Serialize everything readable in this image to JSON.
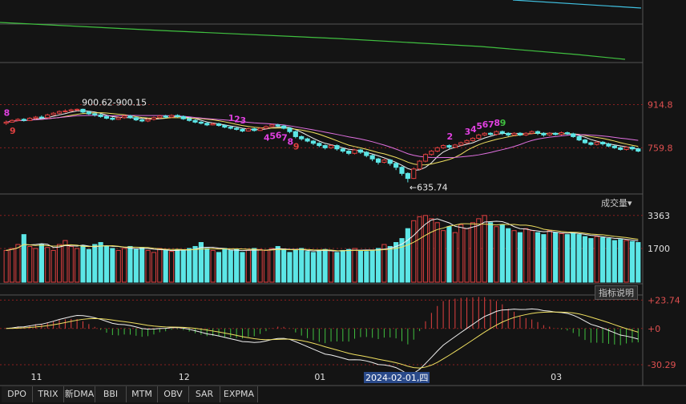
{
  "chart_data": {
    "type": "candlestick",
    "colors": {
      "up": "#e04040",
      "down": "#5ce6e6",
      "ma5": "#f0f0f0",
      "ma10": "#f0e060",
      "ma20": "#e070e0",
      "ma60": "#40c040",
      "ma120": "#40c0e0",
      "grid": "#8a1f1f",
      "axis_text": "#e05050",
      "td_up": "#e040e0",
      "td_down": "#e04040"
    },
    "price_panel": {
      "ylim": [
        600,
        1060
      ],
      "ticks": [
        {
          "value": 914.8,
          "label": "914.8"
        },
        {
          "value": 759.8,
          "label": "759.8"
        }
      ],
      "high_annotation": "900.62-900.15",
      "low_annotation": "←635.74",
      "candles": [
        [
          848,
          852,
          842,
          858
        ],
        [
          852,
          858,
          850,
          862
        ],
        [
          858,
          862,
          855,
          866
        ],
        [
          862,
          858,
          854,
          866
        ],
        [
          858,
          866,
          856,
          870
        ],
        [
          866,
          870,
          862,
          874
        ],
        [
          870,
          868,
          864,
          876
        ],
        [
          868,
          878,
          866,
          882
        ],
        [
          878,
          884,
          876,
          888
        ],
        [
          884,
          890,
          880,
          894
        ],
        [
          890,
          892,
          886,
          898
        ],
        [
          892,
          896,
          890,
          900
        ],
        [
          896,
          898,
          892,
          901
        ],
        [
          898,
          888,
          884,
          900
        ],
        [
          888,
          882,
          878,
          892
        ],
        [
          882,
          878,
          872,
          886
        ],
        [
          878,
          872,
          868,
          882
        ],
        [
          872,
          866,
          862,
          876
        ],
        [
          866,
          862,
          858,
          870
        ],
        [
          862,
          868,
          860,
          872
        ],
        [
          868,
          874,
          864,
          878
        ],
        [
          874,
          868,
          864,
          878
        ],
        [
          868,
          860,
          856,
          872
        ],
        [
          860,
          856,
          852,
          864
        ],
        [
          856,
          862,
          852,
          866
        ],
        [
          862,
          868,
          858,
          872
        ],
        [
          868,
          874,
          864,
          878
        ],
        [
          874,
          870,
          866,
          878
        ],
        [
          870,
          876,
          866,
          880
        ],
        [
          876,
          872,
          868,
          880
        ],
        [
          872,
          864,
          860,
          876
        ],
        [
          864,
          858,
          854,
          868
        ],
        [
          858,
          852,
          848,
          862
        ],
        [
          852,
          848,
          844,
          856
        ],
        [
          848,
          842,
          838,
          852
        ],
        [
          842,
          846,
          840,
          850
        ],
        [
          846,
          840,
          836,
          850
        ],
        [
          840,
          834,
          830,
          844
        ],
        [
          834,
          830,
          826,
          838
        ],
        [
          830,
          826,
          822,
          834
        ],
        [
          826,
          820,
          816,
          830
        ],
        [
          820,
          828,
          818,
          832
        ],
        [
          828,
          822,
          818,
          832
        ],
        [
          822,
          830,
          820,
          834
        ],
        [
          830,
          836,
          826,
          840
        ],
        [
          836,
          842,
          832,
          846
        ],
        [
          842,
          838,
          834,
          846
        ],
        [
          838,
          830,
          826,
          842
        ],
        [
          830,
          818,
          812,
          834
        ],
        [
          818,
          800,
          794,
          822
        ],
        [
          800,
          792,
          786,
          804
        ],
        [
          792,
          784,
          780,
          796
        ],
        [
          784,
          776,
          770,
          788
        ],
        [
          776,
          768,
          762,
          780
        ],
        [
          768,
          760,
          754,
          772
        ],
        [
          760,
          768,
          756,
          772
        ],
        [
          768,
          756,
          750,
          772
        ],
        [
          756,
          748,
          742,
          760
        ],
        [
          748,
          740,
          734,
          752
        ],
        [
          740,
          752,
          736,
          756
        ],
        [
          752,
          744,
          738,
          756
        ],
        [
          744,
          732,
          726,
          748
        ],
        [
          732,
          720,
          712,
          736
        ],
        [
          720,
          708,
          700,
          724
        ],
        [
          708,
          716,
          704,
          720
        ],
        [
          716,
          704,
          696,
          720
        ],
        [
          704,
          690,
          680,
          708
        ],
        [
          690,
          668,
          660,
          694
        ],
        [
          668,
          650,
          636,
          672
        ],
        [
          650,
          684,
          648,
          690
        ],
        [
          684,
          712,
          680,
          716
        ],
        [
          712,
          736,
          708,
          740
        ],
        [
          736,
          748,
          732,
          752
        ],
        [
          748,
          760,
          744,
          764
        ],
        [
          760,
          768,
          756,
          772
        ],
        [
          768,
          762,
          756,
          772
        ],
        [
          762,
          770,
          758,
          774
        ],
        [
          770,
          778,
          766,
          782
        ],
        [
          778,
          786,
          774,
          790
        ],
        [
          786,
          794,
          782,
          798
        ],
        [
          794,
          806,
          790,
          810
        ],
        [
          806,
          812,
          802,
          816
        ],
        [
          812,
          808,
          804,
          816
        ],
        [
          808,
          818,
          804,
          822
        ],
        [
          818,
          812,
          806,
          822
        ],
        [
          812,
          806,
          800,
          816
        ],
        [
          806,
          812,
          802,
          816
        ],
        [
          812,
          806,
          802,
          816
        ],
        [
          806,
          812,
          802,
          816
        ],
        [
          812,
          818,
          808,
          822
        ],
        [
          818,
          812,
          806,
          822
        ],
        [
          812,
          806,
          800,
          816
        ],
        [
          806,
          812,
          802,
          816
        ],
        [
          812,
          808,
          804,
          816
        ],
        [
          808,
          814,
          804,
          818
        ],
        [
          814,
          810,
          806,
          818
        ],
        [
          810,
          800,
          796,
          814
        ],
        [
          800,
          788,
          784,
          804
        ],
        [
          788,
          778,
          774,
          792
        ],
        [
          778,
          772,
          768,
          782
        ],
        [
          772,
          780,
          768,
          784
        ],
        [
          780,
          774,
          768,
          784
        ],
        [
          774,
          766,
          762,
          778
        ],
        [
          766,
          760,
          756,
          770
        ],
        [
          760,
          754,
          750,
          764
        ],
        [
          754,
          762,
          750,
          766
        ],
        [
          762,
          756,
          750,
          766
        ],
        [
          756,
          748,
          744,
          760
        ]
      ],
      "td_labels": [
        {
          "i": 0,
          "text": "8",
          "pos": "above",
          "color": "td_up"
        },
        {
          "i": 1,
          "text": "9",
          "pos": "below",
          "color": "td_down"
        },
        {
          "i": 38,
          "text": "1",
          "pos": "above",
          "color": "td_up"
        },
        {
          "i": 39,
          "text": "2",
          "pos": "above",
          "color": "td_up"
        },
        {
          "i": 40,
          "text": "3",
          "pos": "above",
          "color": "td_up"
        },
        {
          "i": 44,
          "text": "4",
          "pos": "below",
          "color": "td_up"
        },
        {
          "i": 45,
          "text": "5",
          "pos": "below",
          "color": "td_up"
        },
        {
          "i": 46,
          "text": "6",
          "pos": "below",
          "color": "td_up"
        },
        {
          "i": 47,
          "text": "7",
          "pos": "below",
          "color": "td_up"
        },
        {
          "i": 48,
          "text": "8",
          "pos": "below",
          "color": "td_up"
        },
        {
          "i": 49,
          "text": "9",
          "pos": "below",
          "color": "td_down"
        },
        {
          "i": 75,
          "text": "2",
          "pos": "above",
          "color": "td_up"
        },
        {
          "i": 78,
          "text": "3",
          "pos": "above",
          "color": "td_up"
        },
        {
          "i": 79,
          "text": "4",
          "pos": "above",
          "color": "td_up"
        },
        {
          "i": 80,
          "text": "5",
          "pos": "above",
          "color": "td_up"
        },
        {
          "i": 81,
          "text": "6",
          "pos": "above",
          "color": "td_up"
        },
        {
          "i": 82,
          "text": "7",
          "pos": "above",
          "color": "td_up"
        },
        {
          "i": 83,
          "text": "8",
          "pos": "above",
          "color": "td_up"
        },
        {
          "i": 84,
          "text": "9",
          "pos": "above",
          "color": "ma60"
        }
      ]
    },
    "volume_panel": {
      "label": "成交量",
      "ylim": [
        0,
        3800
      ],
      "ticks": [
        {
          "value": 3363,
          "label": "3363"
        },
        {
          "value": 1700,
          "label": "1700"
        }
      ],
      "values": [
        1600,
        1700,
        1900,
        2400,
        1800,
        1700,
        1900,
        1750,
        1600,
        1900,
        2100,
        1800,
        1700,
        1850,
        1650,
        1900,
        2000,
        1800,
        1700,
        1600,
        1700,
        1800,
        1650,
        1750,
        1600,
        1500,
        1700,
        1600,
        1550,
        1650,
        1600,
        1700,
        1800,
        2000,
        1700,
        1600,
        1500,
        1700,
        1600,
        1650,
        1500,
        1600,
        1700,
        1650,
        1600,
        1700,
        1800,
        1650,
        1500,
        1600,
        1700,
        1550,
        1500,
        1600,
        1650,
        1600,
        1500,
        1600,
        1650,
        1700,
        1600,
        1550,
        1600,
        1700,
        1900,
        1800,
        2000,
        2200,
        2700,
        3100,
        3300,
        3363,
        3200,
        3000,
        2600,
        2800,
        2500,
        2900,
        2700,
        3000,
        3200,
        3363,
        3000,
        2800,
        2900,
        2700,
        2600,
        2500,
        2700,
        2600,
        2500,
        2400,
        2600,
        2500,
        2450,
        2400,
        2500,
        2400,
        2300,
        2200,
        2300,
        2250,
        2200,
        2100,
        2150,
        2100,
        2050,
        2000
      ]
    },
    "macd_panel": {
      "label": "指标说明",
      "ylim": [
        -35,
        28
      ],
      "ticks": [
        {
          "value": 23.74,
          "label": "+23.74"
        },
        {
          "value": 0,
          "label": "+0"
        },
        {
          "value": -30.29,
          "label": "-30.29"
        }
      ]
    },
    "x_labels": [
      {
        "i": 5,
        "text": "11"
      },
      {
        "i": 30,
        "text": "12"
      },
      {
        "i": 53,
        "text": "01"
      },
      {
        "i": 93,
        "text": "03"
      }
    ],
    "crosshair_date": "2024-02-01,四"
  },
  "tabs": [
    "DPO",
    "TRIX",
    "新DMA",
    "BBI",
    "MTM",
    "OBV",
    "SAR",
    "EXPMA"
  ]
}
